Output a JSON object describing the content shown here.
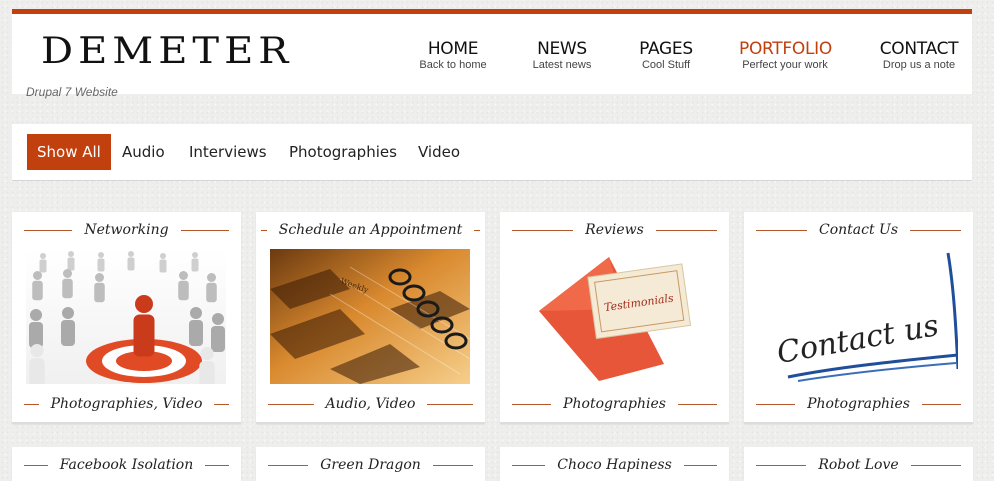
{
  "site": {
    "name": "DEMETER",
    "slogan": "Drupal 7 Website"
  },
  "nav": [
    {
      "label": "HOME",
      "sub": "Back to home"
    },
    {
      "label": "NEWS",
      "sub": "Latest news"
    },
    {
      "label": "PAGES",
      "sub": "Cool Stuff"
    },
    {
      "label": "PORTFOLIO",
      "sub": "Perfect your work",
      "active": true
    },
    {
      "label": "CONTACT",
      "sub": "Drop us a note"
    }
  ],
  "filters": [
    "Show All",
    "Audio",
    "Interviews",
    "Photographies",
    "Video"
  ],
  "cards": [
    {
      "title": "Networking",
      "category": "Photographies, Video",
      "image": "people-target-icon"
    },
    {
      "title": "Schedule an Appointment",
      "category": "Audio, Video",
      "image": "planner-notebook-icon"
    },
    {
      "title": "Reviews",
      "category": "Photographies",
      "image": "envelope-card-icon",
      "image_text": "Testimonials"
    },
    {
      "title": "Contact Us",
      "category": "Photographies",
      "image": "handwriting-icon",
      "image_text": "Contact us"
    },
    {
      "title": "Facebook Isolation"
    },
    {
      "title": "Green Dragon"
    },
    {
      "title": "Choco Hapiness"
    },
    {
      "title": "Robot Love"
    }
  ],
  "colors": {
    "accent": "#c23f0e",
    "background": "#eeeeec",
    "card": "#ffffff",
    "rule": "#b5582d"
  }
}
